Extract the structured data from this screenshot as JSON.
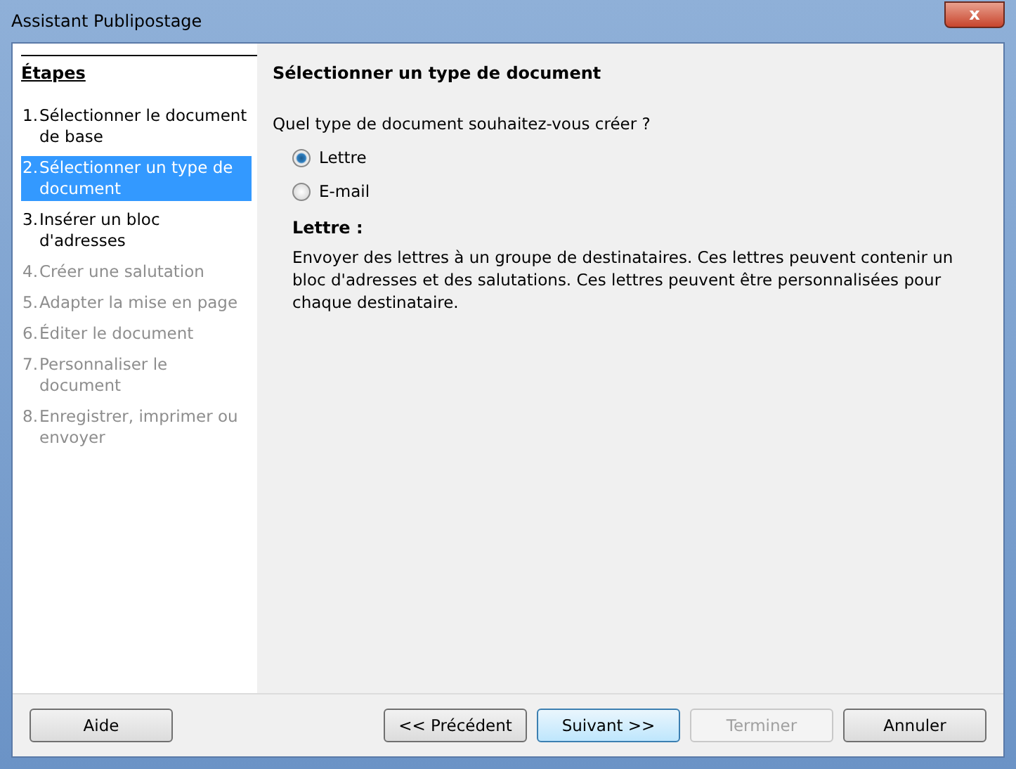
{
  "window": {
    "title": "Assistant Publipostage",
    "close_label": "x"
  },
  "sidebar": {
    "heading": "Étapes",
    "items": [
      {
        "number": "1.",
        "label": "Sélectionner le document de base",
        "selected": false,
        "disabled": false
      },
      {
        "number": "2.",
        "label": "Sélectionner un type de document",
        "selected": true,
        "disabled": false
      },
      {
        "number": "3.",
        "label": "Insérer un bloc d'adresses",
        "selected": false,
        "disabled": false
      },
      {
        "number": "4.",
        "label": "Créer une salutation",
        "selected": false,
        "disabled": true
      },
      {
        "number": "5.",
        "label": "Adapter la mise en page",
        "selected": false,
        "disabled": true
      },
      {
        "number": "6.",
        "label": "Éditer le document",
        "selected": false,
        "disabled": true
      },
      {
        "number": "7.",
        "label": "Personnaliser le document",
        "selected": false,
        "disabled": true
      },
      {
        "number": "8.",
        "label": "Enregistrer, imprimer ou envoyer",
        "selected": false,
        "disabled": true
      }
    ]
  },
  "content": {
    "title": "Sélectionner un type de document",
    "question": "Quel type de document souhaitez-vous créer ?",
    "options": [
      {
        "label": "Lettre",
        "selected": true
      },
      {
        "label": "E-mail",
        "selected": false
      }
    ],
    "description_title": "Lettre :",
    "description": "Envoyer des lettres à un groupe de destinataires. Ces lettres peuvent contenir un bloc d'adresses et des salutations. Ces lettres peuvent être personnalisées pour chaque destinataire."
  },
  "buttons": [
    {
      "label": "Aide",
      "kind": "help",
      "disabled": false,
      "focused": false
    },
    {
      "label": "<< Précédent",
      "kind": "nav",
      "disabled": false,
      "focused": false
    },
    {
      "label": "Suivant >>",
      "kind": "nav",
      "disabled": false,
      "focused": true
    },
    {
      "label": "Terminer",
      "kind": "nav",
      "disabled": true,
      "focused": false
    },
    {
      "label": "Annuler",
      "kind": "cancel",
      "disabled": false,
      "focused": false
    }
  ]
}
